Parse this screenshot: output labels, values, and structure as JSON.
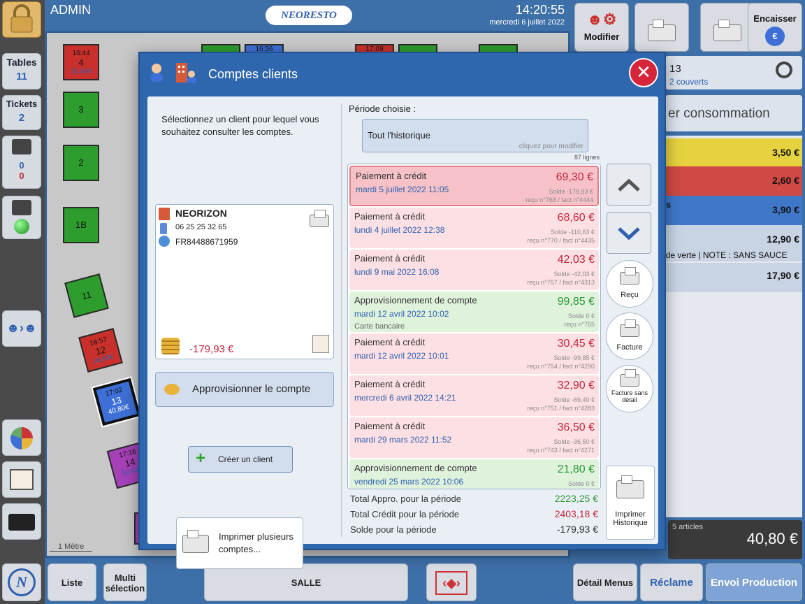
{
  "topbar": {
    "user": "ADMIN",
    "logo": "NEORESTO",
    "time": "14:20:55",
    "date": "mercredi 6 juillet 2022"
  },
  "left_sidebar": {
    "tables_label": "Tables",
    "tables_count": "11",
    "tickets_label": "Tickets",
    "tickets_count": "2",
    "cart_count_blue": "0",
    "cart_count_red": "0"
  },
  "floor": {
    "scale_label": "1 Mètre",
    "tables": [
      {
        "time": "16:44",
        "name": "4",
        "amount": "30,60€"
      },
      {
        "name": "3"
      },
      {
        "name": "2"
      },
      {
        "name": "1B"
      },
      {
        "name": "11"
      },
      {
        "time": "16:57",
        "name": "12",
        "amount": "16,60€"
      },
      {
        "time": "17:02",
        "name": "13",
        "amount": "40,80€"
      },
      {
        "time": "17:16",
        "name": "14",
        "amount": "30,60€"
      },
      {
        "time": "16:56"
      },
      {
        "time": "17:09"
      }
    ]
  },
  "right_panel": {
    "modifier_label": "Modifier",
    "encaisser_label": "Encaisser",
    "couverts_count": "13",
    "couverts_label": "2 couverts",
    "consommation_text": "er consommation",
    "lines": [
      {
        "text": "",
        "price": "3,50 €",
        "color": "#e6d23e"
      },
      {
        "text": "",
        "price": "2,60 €",
        "color": "#cf4a44"
      },
      {
        "text": "ns",
        "price": "3,90 €",
        "color": "#3f78c8"
      },
      {
        "text": "ade verte | NOTE : SANS SAUCE",
        "price": "12,90 €",
        "color": "#c8d4e4"
      },
      {
        "text": "",
        "price": "17,90 €",
        "color": "#c8d4e4"
      }
    ],
    "articles": "5 articles",
    "total": "40,80 €",
    "btn_detail": "Détail Menus",
    "btn_reclame": "Réclame",
    "btn_envoi": "Envoi Production"
  },
  "bottom": {
    "liste": "Liste",
    "multi": "Multi sélection",
    "salle": "SALLE"
  },
  "modal": {
    "title": "Comptes clients",
    "instructions": "Sélectionnez un client pour lequel vous souhaitez consulter les comptes.",
    "client": {
      "name": "NEORIZON",
      "phone": "06 25 25 32 65",
      "vat": "FR84488671959",
      "balance": "-179,93 €"
    },
    "approvisionner": "Approvisionner le compte",
    "creer_client": "Créer un client",
    "imprimer_plusieurs": "Imprimer plusieurs comptes...",
    "periode_label": "Période choisie :",
    "periode_value": "Tout l'historique",
    "periode_hint": "cliquez pour modifier",
    "lines_count": "87 lignes",
    "entries": [
      {
        "type": "Paiement à crédit",
        "date": "mardi 5 juillet 2022 11:05",
        "amount": "69,30 €",
        "solde": "Solde -179,93 €",
        "ref": "reçu n°768 / fact n°4444",
        "kind": "credit",
        "selected": true
      },
      {
        "type": "Paiement à crédit",
        "date": "lundi 4 juillet 2022 12:38",
        "amount": "68,60 €",
        "solde": "Solde -110,63 €",
        "ref": "reçu n°770 / fact n°4435",
        "kind": "credit"
      },
      {
        "type": "Paiement à crédit",
        "date": "lundi 9 mai 2022 16:08",
        "amount": "42,03 €",
        "solde": "Solde -42,03 €",
        "ref": "reçu n°757 / fact n°4313",
        "kind": "credit"
      },
      {
        "type": "Approvisionnement de compte",
        "date": "mardi 12 avril 2022 10:02",
        "sub": "Carte bancaire",
        "amount": "99,85 €",
        "solde": "Solde 0 €",
        "ref": "reçu n°755",
        "kind": "appro"
      },
      {
        "type": "Paiement à crédit",
        "date": "mardi 12 avril 2022 10:01",
        "amount": "30,45 €",
        "solde": "Solde -99,85 €",
        "ref": "reçu n°754 / fact n°4290",
        "kind": "credit"
      },
      {
        "type": "Paiement à crédit",
        "date": "mercredi 6 avril 2022 14:21",
        "amount": "32,90 €",
        "solde": "Solde -69,40 €",
        "ref": "reçu n°751 / fact n°4283",
        "kind": "credit"
      },
      {
        "type": "Paiement à crédit",
        "date": "mardi 29 mars 2022 11:52",
        "amount": "36,50 €",
        "solde": "Solde -36,50 €",
        "ref": "reçu n°743 / fact n°4271",
        "kind": "credit"
      },
      {
        "type": "Approvisionnement de compte",
        "date": "vendredi 25 mars 2022 10:06",
        "amount": "21,80 €",
        "solde": "Solde 0 €",
        "ref": "",
        "kind": "appro"
      }
    ],
    "totals": [
      {
        "label": "Total Appro. pour la période",
        "value": "2223,25 €",
        "color": "#2a9a35"
      },
      {
        "label": "Total Crédit pour la période",
        "value": "2403,18 €",
        "color": "#c3263a"
      },
      {
        "label": "Solde pour la période",
        "value": "-179,93 €",
        "color": "#333"
      }
    ],
    "btn_recu": "Reçu",
    "btn_facture": "Facture",
    "btn_facture_sans_detail": "Facture sans détail",
    "btn_imprimer_historique": "Imprimer Historique"
  }
}
